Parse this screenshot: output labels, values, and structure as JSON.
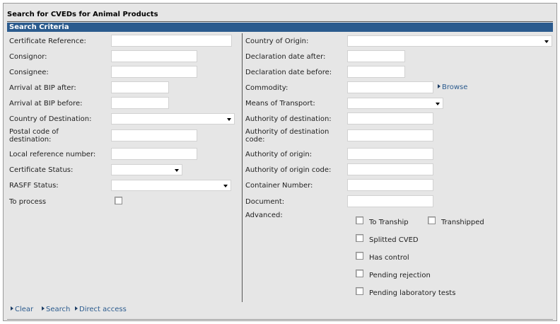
{
  "page": {
    "title": "Search for CVEDs for Animal Products",
    "section_header": "Search Criteria"
  },
  "left": {
    "certificate_reference": {
      "label": "Certificate Reference:",
      "value": ""
    },
    "consignor": {
      "label": "Consignor:",
      "value": ""
    },
    "consignee": {
      "label": "Consignee:",
      "value": ""
    },
    "arrival_after": {
      "label": "Arrival at BIP after:",
      "value": ""
    },
    "arrival_before": {
      "label": "Arrival at BIP before:",
      "value": ""
    },
    "country_destination": {
      "label": "Country of Destination:",
      "selected": ""
    },
    "postal_code": {
      "label": "Postal code of destination:",
      "value": ""
    },
    "local_reference": {
      "label": "Local reference number:",
      "value": ""
    },
    "certificate_status": {
      "label": "Certificate Status:",
      "selected": ""
    },
    "rasff_status": {
      "label": "RASFF Status:",
      "selected": ""
    },
    "to_process": {
      "label": "To process",
      "checked": false
    }
  },
  "right": {
    "country_origin": {
      "label": "Country of Origin:",
      "selected": ""
    },
    "declaration_after": {
      "label": "Declaration date after:",
      "value": ""
    },
    "declaration_before": {
      "label": "Declaration date before:",
      "value": ""
    },
    "commodity": {
      "label": "Commodity:",
      "value": "",
      "browse_label": "Browse"
    },
    "means_transport": {
      "label": "Means of Transport:",
      "selected": ""
    },
    "authority_destination": {
      "label": "Authority of destination:",
      "value": ""
    },
    "authority_destination_code": {
      "label": "Authority of destination code:",
      "value": ""
    },
    "authority_origin": {
      "label": "Authority of origin:",
      "value": ""
    },
    "authority_origin_code": {
      "label": "Authority of origin code:",
      "value": ""
    },
    "container_number": {
      "label": "Container Number:",
      "value": ""
    },
    "document": {
      "label": "Document:",
      "value": ""
    },
    "advanced": {
      "label": "Advanced:",
      "options": [
        {
          "label": "To Tranship",
          "checked": false
        },
        {
          "label": "Transhipped",
          "checked": false
        },
        {
          "label": "Splitted CVED",
          "checked": false
        },
        {
          "label": "Has control",
          "checked": false
        },
        {
          "label": "Pending rejection",
          "checked": false
        },
        {
          "label": "Pending laboratory tests",
          "checked": false
        }
      ]
    }
  },
  "actions": {
    "clear": "Clear",
    "search": "Search",
    "direct_access": "Direct access"
  },
  "colors": {
    "header_blue": "#2b5b8e",
    "panel_bg": "#e6e6e6",
    "link": "#2b5b8e"
  }
}
